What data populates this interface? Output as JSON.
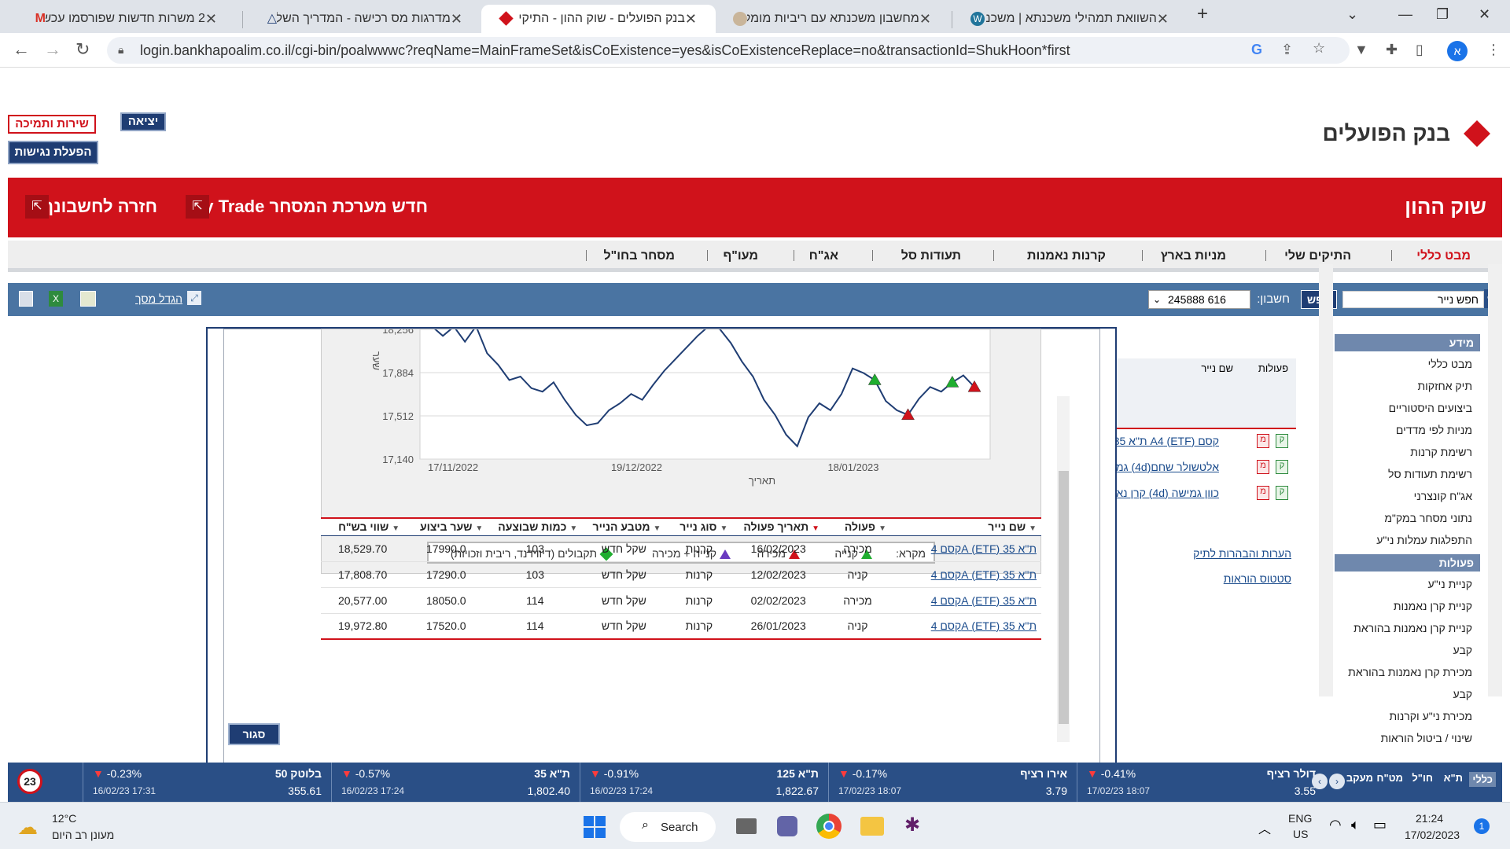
{
  "browser": {
    "tabs": [
      {
        "title": "2 משרות חדשות שפורסמו עכשיו",
        "icon": "gmail-icon",
        "active": false
      },
      {
        "title": "מדרגות מס רכישה - המדריך השל",
        "icon": "triangle-logo-icon",
        "active": false
      },
      {
        "title": "בנק הפועלים - שוק ההון - התיקי",
        "icon": "hapoalim-diamond-icon",
        "active": true
      },
      {
        "title": "מחשבון משכנתא עם ריביות מומל",
        "icon": "person-avatar-icon",
        "active": false
      },
      {
        "title": "השוואת תמהילי משכנתא | משכנ",
        "icon": "wordpress-icon",
        "active": false
      }
    ],
    "url": "login.bankhapoalim.co.il/cgi-bin/poalwwwc?reqName=MainFrameSet&isCoExistence=yes&isCoExistenceReplace=no&transactionId=ShukHoon*first",
    "profile_initial": "א"
  },
  "header": {
    "service_button": "שירות ותמיכה",
    "exit_button": "יציאה",
    "accessibility_button": "הפעלת נגישות",
    "bank_name": "בנק הפועלים",
    "section_title": "שוק ההון",
    "mytrade_link": "חדש מערכת המסחר My Trade",
    "back_link": "חזרה לחשבונך"
  },
  "nav": {
    "items": [
      "מבט כללי",
      "התיקים שלי",
      "מניות בארץ",
      "קרנות נאמנות",
      "תעודות סל",
      "אג\"ח",
      "מעו\"ף",
      "מסחר בחו\"ל"
    ],
    "active_index": 0,
    "active_color": "#d0121b"
  },
  "toolbar": {
    "search_placeholder": "חפש נייר",
    "find_button": "חפש",
    "account_label": "חשבון:",
    "account_value": "245888 616",
    "enlarge_link": "הגדל מסך"
  },
  "sidebar": {
    "info_header": "מידע",
    "info_items": [
      "מבט כללי",
      "תיק אחזקות",
      "ביצועים היסטוריים",
      "מניות לפי מדדים",
      "רשימת קרנות",
      "רשימת תעודות סל",
      "אג\"ח קונצרני",
      "נתוני מסחר במק\"מ",
      "התפלגות עמלות ני\"ע"
    ],
    "actions_header": "פעולות",
    "action_items": [
      "קניית ני\"ע",
      "קניית קרן נאמנות",
      "קניית קרן נאמנות בהוראת",
      "קבע",
      "מכירת קרן נאמנות בהוראת",
      "קבע",
      "מכירת ני\"ע וקרנות",
      "שינוי / ביטול הוראות"
    ]
  },
  "holdings": {
    "col_actions": "פעולות",
    "col_name": "שם נייר",
    "rows": [
      "קסם (ETF) A4 ת\"א 35",
      "אלטשולר שחם(4d) גמי",
      "כוון גמישה (4d) קרן נא"
    ],
    "notes_link": "הערות והבהרות לתיק",
    "status_link": "סטטוס הוראות"
  },
  "chart_data": {
    "type": "line",
    "ylabel": "שער",
    "xlabel": "תאריך",
    "y_ticks": [
      "18,256",
      "17,884",
      "17,512",
      "17,140"
    ],
    "x_ticks": [
      "17/11/2022",
      "19/12/2022",
      "18/01/2023"
    ],
    "ylim": [
      17140,
      18256
    ],
    "series": [
      {
        "values": [
          18300,
          18200,
          18280,
          18150,
          18300,
          18050,
          17950,
          17820,
          17850,
          17750,
          17720,
          17800,
          17650,
          17520,
          17430,
          17450,
          17560,
          17620,
          17700,
          17650,
          17780,
          17900,
          18000,
          18100,
          18200,
          18300,
          18260,
          18140,
          17980,
          17850,
          17650,
          17520,
          17350,
          17250,
          17500,
          17620,
          17560,
          17700,
          17920,
          17880,
          17820,
          17640,
          17560,
          17520,
          17660,
          17760,
          17720,
          17800,
          17860,
          17760
        ]
      }
    ],
    "markers": [
      {
        "type": "buy",
        "index": 40
      },
      {
        "type": "sell",
        "index": 43
      },
      {
        "type": "buy",
        "index": 47
      },
      {
        "type": "sell",
        "index": 49
      }
    ],
    "colors": {
      "line": "#1f3d73",
      "buy": "#1fae2f",
      "sell": "#d0121b"
    }
  },
  "legend": {
    "label": "מקרא:",
    "buy": "קנייה",
    "sell": "מכירה",
    "buy_sell": "קנייה + מכירה",
    "dividends": "תקבולים (דיווידנד, ריבית וזכויות)"
  },
  "transactions": {
    "headers": [
      "שם נייר",
      "פעולה",
      "תאריך פעולה",
      "סוג נייר",
      "מטבע הנייר",
      "כמות שבוצעה",
      "שער ביצוע",
      "שווי בש\"ח"
    ],
    "rows": [
      [
        "ת\"א 35 (ETF) Aקסם 4",
        "מכירה",
        "16/02/2023",
        "קרנות",
        "שקל חדש",
        "103",
        "17990.0",
        "18,529.70"
      ],
      [
        "ת\"א 35 (ETF) Aקסם 4",
        "קניה",
        "12/02/2023",
        "קרנות",
        "שקל חדש",
        "103",
        "17290.0",
        "17,808.70"
      ],
      [
        "ת\"א 35 (ETF) Aקסם 4",
        "מכירה",
        "02/02/2023",
        "קרנות",
        "שקל חדש",
        "114",
        "18050.0",
        "20,577.00"
      ],
      [
        "ת\"א 35 (ETF) Aקסם 4",
        "קניה",
        "26/01/2023",
        "קרנות",
        "שקל חדש",
        "114",
        "17520.0",
        "19,972.80"
      ]
    ],
    "close_button": "סגור"
  },
  "ticker": {
    "tabs": [
      "כללי",
      "ת\"א",
      "חו\"ל",
      "מט\"ח",
      "מעקב"
    ],
    "items": [
      {
        "name": "דולר רציף",
        "change": "-0.41%",
        "value": "3.55",
        "time": "17/02/23 18:07"
      },
      {
        "name": "אירו רציף",
        "change": "-0.17%",
        "value": "3.79",
        "time": "17/02/23 18:07"
      },
      {
        "name": "ת\"א 125",
        "change": "-0.91%",
        "value": "1,822.67",
        "time": "16/02/23 17:24"
      },
      {
        "name": "ת\"א 35",
        "change": "-0.57%",
        "value": "1,802.40",
        "time": "16/02/23 17:24"
      },
      {
        "name": "בלוטק 50",
        "change": "-0.23%",
        "value": "355.61",
        "time": "16/02/23 17:31"
      }
    ],
    "badge": "23"
  },
  "taskbar": {
    "temperature": "12°C",
    "weather": "מעונן רב היום",
    "search": "Search",
    "lang1": "ENG",
    "lang2": "US",
    "time": "21:24",
    "date": "17/02/2023",
    "notif": "1"
  }
}
